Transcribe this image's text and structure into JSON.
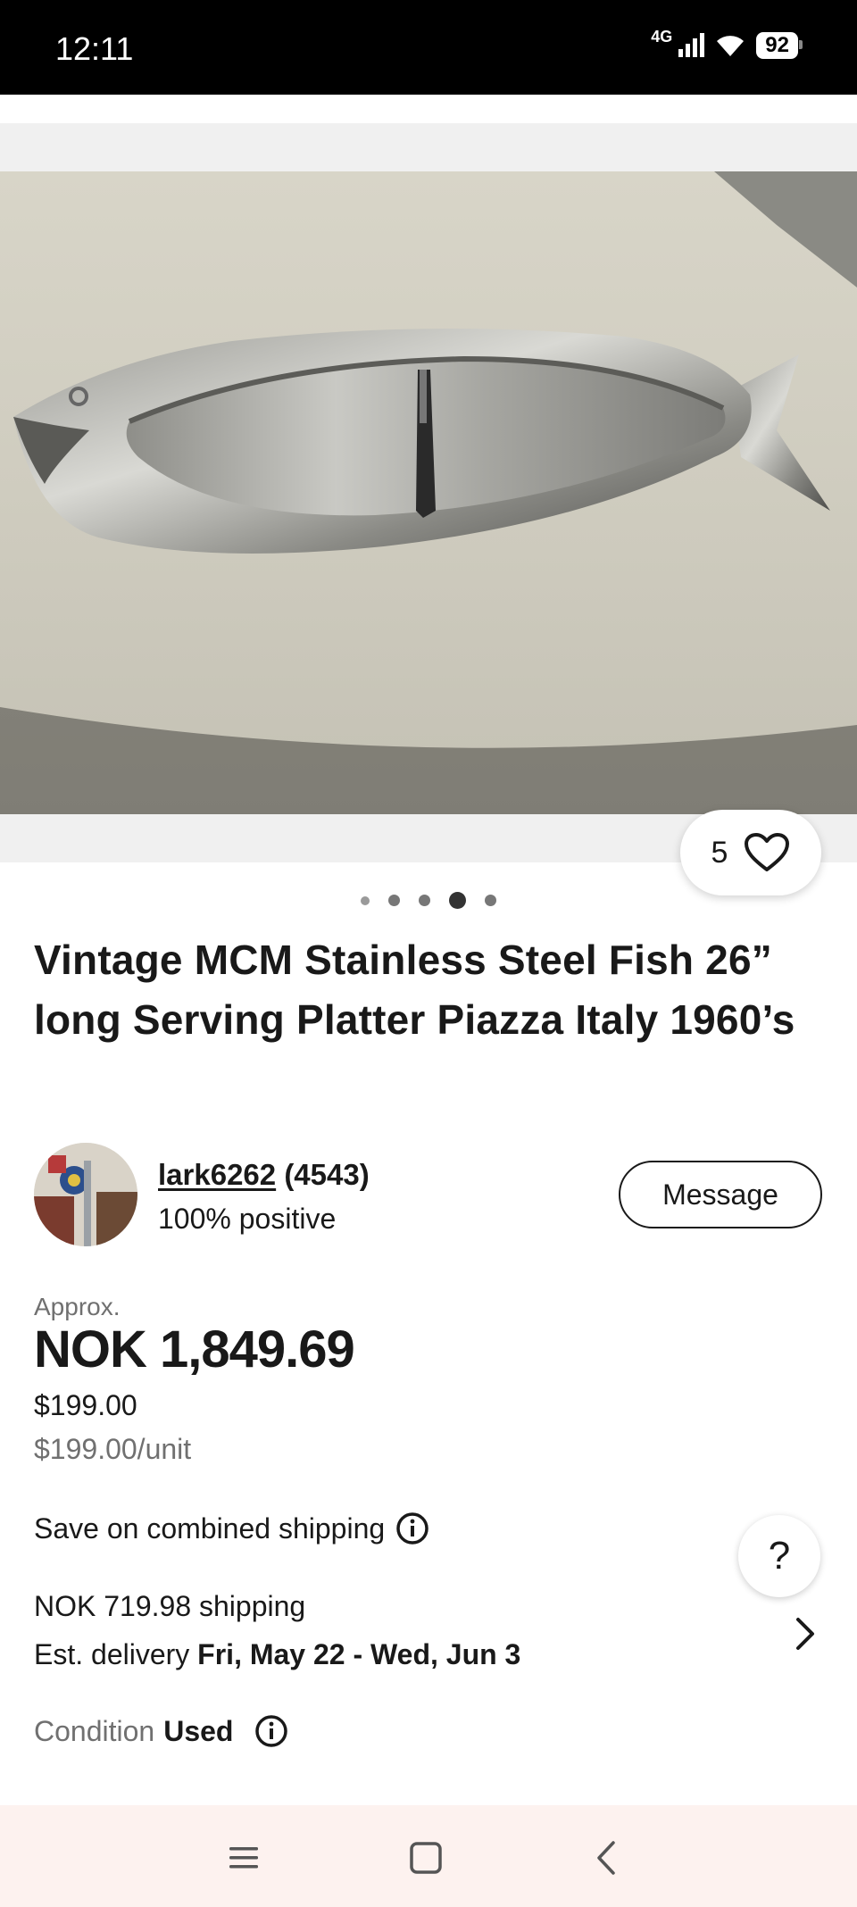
{
  "status_bar": {
    "time": "12:11",
    "network": "4G",
    "battery": "92"
  },
  "gallery": {
    "image_count": 5,
    "active_index": 3,
    "watch_count": "5"
  },
  "listing": {
    "title": "Vintage MCM Stainless Steel Fish 26” long Serving Platter Piazza Italy 1960’s"
  },
  "seller": {
    "name": "lark6262",
    "feedback_count": "(4543)",
    "positive": "100% positive",
    "message_label": "Message"
  },
  "pricing": {
    "approx_label": "Approx.",
    "price_converted": "NOK 1,849.69",
    "price_usd": "$199.00",
    "price_per_unit": "$199.00/unit"
  },
  "shipping": {
    "combined_label": "Save on combined shipping",
    "cost": "NOK 719.98 shipping",
    "est_label": "Est. delivery",
    "est_dates": "Fri, May 22 - Wed, Jun 3"
  },
  "condition": {
    "label": "Condition",
    "value": "Used"
  },
  "help": {
    "label": "?"
  },
  "colors": {
    "text": "#191919",
    "muted": "#707070",
    "nav_background": "#fdf2ef"
  }
}
